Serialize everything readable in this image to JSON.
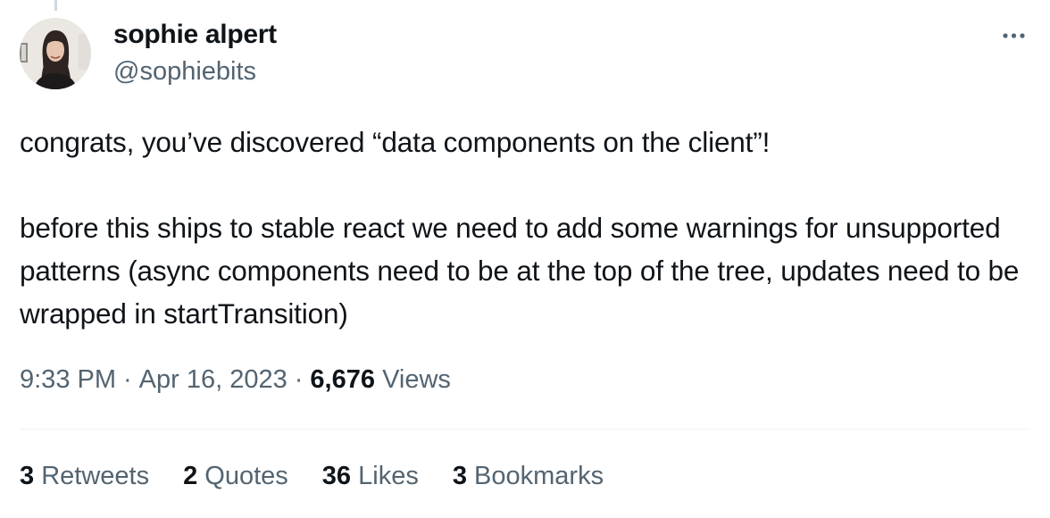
{
  "author": {
    "display_name": "sophie alpert",
    "handle": "@sophiebits",
    "avatar_icon": "profile-photo"
  },
  "tweet": {
    "paragraphs": [
      "congrats, you’ve discovered “data components on the client”!",
      "before this ships to stable react we need to add some warnings for unsupported patterns (async components need to be at the top of the tree, updates need to be wrapped in startTransition)"
    ]
  },
  "meta": {
    "time": "9:33 PM",
    "separator": "·",
    "date": "Apr 16, 2023",
    "views_count": "6,676",
    "views_label": "Views"
  },
  "stats": [
    {
      "count": "3",
      "label": "Retweets"
    },
    {
      "count": "2",
      "label": "Quotes"
    },
    {
      "count": "36",
      "label": "Likes"
    },
    {
      "count": "3",
      "label": "Bookmarks"
    }
  ],
  "more_icon": "more-horizontal-icon",
  "colors": {
    "text_primary": "#0f1419",
    "text_secondary": "#536471",
    "divider": "#eff3f4"
  }
}
